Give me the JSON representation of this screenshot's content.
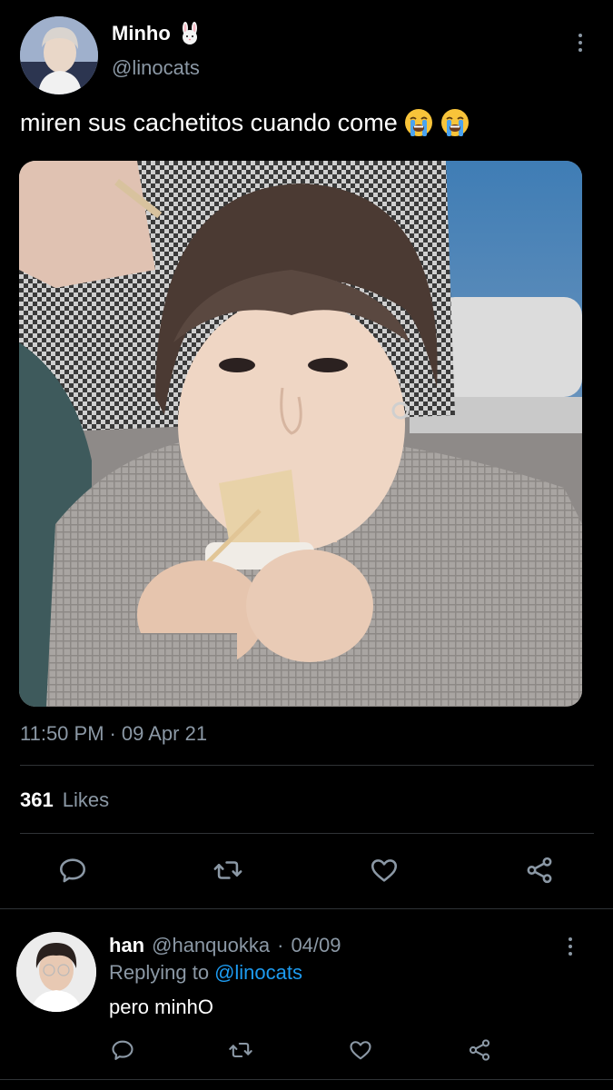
{
  "tweet": {
    "author": {
      "display_name": "Minho",
      "name_emoji": "rabbit-face-emoji",
      "handle": "@linocats"
    },
    "text": "miren sus cachetitos cuando come",
    "text_emojis": [
      "loudly-crying-face-emoji",
      "loudly-crying-face-emoji"
    ],
    "media_description_icon": "photo",
    "time": "11:50 PM",
    "separator": "·",
    "date": "09 Apr 21",
    "likes": {
      "count": "361",
      "label": "Likes"
    },
    "actions": [
      "reply-icon",
      "retweet-icon",
      "like-icon",
      "share-icon"
    ]
  },
  "reply": {
    "display_name": "han",
    "handle": "@hanquokka",
    "separator": "·",
    "date": "04/09",
    "replying_prefix": "Replying to",
    "replying_to": "@linocats",
    "text": "pero minhO",
    "actions": [
      "reply-icon",
      "retweet-icon",
      "like-icon",
      "share-icon"
    ]
  },
  "colors": {
    "background": "#000000",
    "primary_text": "#ffffff",
    "secondary_text": "#8b98a5",
    "link": "#1d9bf0",
    "divider": "#2f3336"
  }
}
